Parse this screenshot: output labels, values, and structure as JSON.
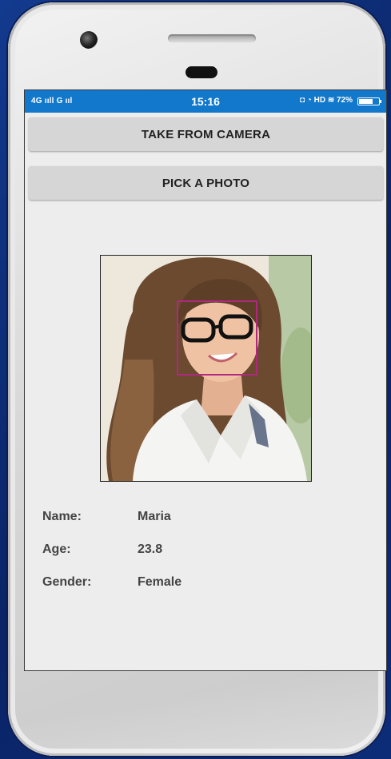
{
  "status_bar": {
    "network": "4G ııll G ııl",
    "time": "15:16",
    "indicators": "◘ ◔ HD ≋ 72%",
    "battery_level": 0.72
  },
  "buttons": {
    "take_from_camera": "TAKE FROM CAMERA",
    "pick_a_photo": "PICK A PHOTO"
  },
  "photo": {
    "icon": "portrait-photo",
    "face_box_color": "#b0287f"
  },
  "info": {
    "name_label": "Name:",
    "name_value": "Maria",
    "age_label": "Age:",
    "age_value": "23.8",
    "gender_label": "Gender:",
    "gender_value": "Female"
  },
  "colors": {
    "status_bar": "#1278cc",
    "background": "#0e2f7a",
    "screen": "#ededed"
  }
}
